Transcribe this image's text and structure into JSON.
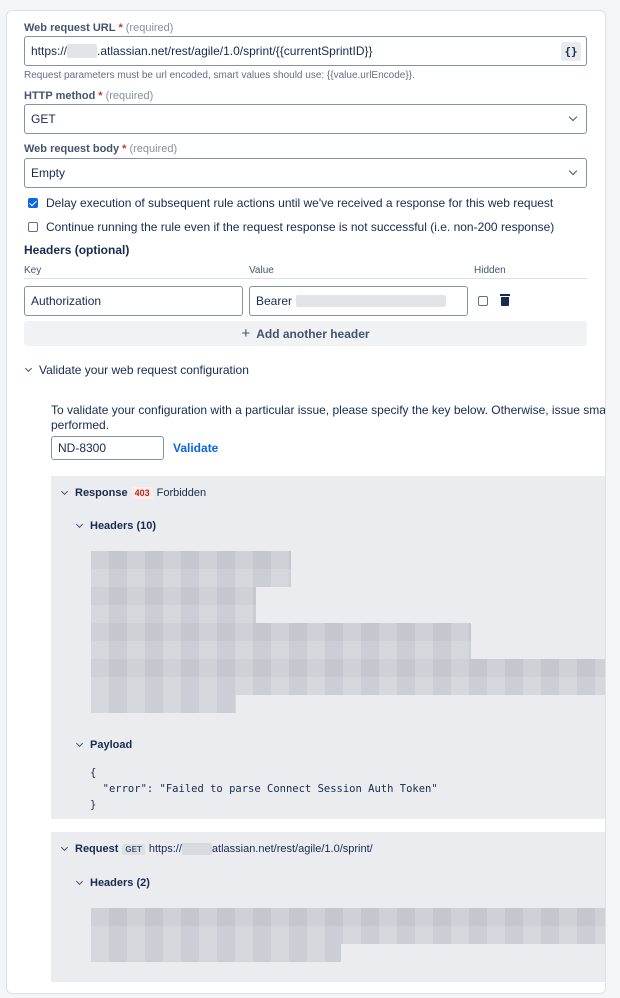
{
  "url_field": {
    "label": "Web request URL",
    "required_star": "*",
    "required_text": "(required)",
    "prefix": "https://",
    "suffix": ".atlassian.net/rest/agile/1.0/sprint/{{currentSprintID}}",
    "smart_value_button": "{}",
    "helper": "Request parameters must be url encoded, smart values should use: {{value.urlEncode}}."
  },
  "method_field": {
    "label": "HTTP method",
    "required_star": "*",
    "required_text": "(required)",
    "value": "GET"
  },
  "body_field": {
    "label": "Web request body",
    "required_star": "*",
    "required_text": "(required)",
    "value": "Empty"
  },
  "checkboxes": {
    "delay": {
      "label": "Delay execution of subsequent rule actions until we've received a response for this web request",
      "checked": true
    },
    "continue": {
      "label": "Continue running the rule even if the request response is not successful (i.e. non-200 response)",
      "checked": false
    }
  },
  "headers": {
    "title": "Headers (optional)",
    "col_key": "Key",
    "col_value": "Value",
    "col_hidden": "Hidden",
    "rows": [
      {
        "key": "Authorization",
        "value_prefix": "Bearer ",
        "hidden": false
      }
    ],
    "add_button": "Add another header"
  },
  "validate": {
    "toggle_label": "Validate your web request configuration",
    "description_line1": "To validate your configuration with a particular issue, please specify the key below. Otherwise, issue smart value su",
    "description_line2": "performed.",
    "issue_key": "ND-8300",
    "validate_link": "Validate"
  },
  "response": {
    "label": "Response",
    "status_code": "403",
    "status_text": "Forbidden",
    "headers_label": "Headers (10)",
    "payload_label": "Payload",
    "payload": "{\n  \"error\": \"Failed to parse Connect Session Auth Token\"\n}"
  },
  "request": {
    "label": "Request",
    "method": "GET",
    "url_prefix": "https://",
    "url_suffix": "atlassian.net/rest/agile/1.0/sprint/",
    "headers_label": "Headers (2)"
  },
  "colors": {
    "accent": "#0c66e4",
    "error": "#ae2e24",
    "required": "#c9372c"
  }
}
